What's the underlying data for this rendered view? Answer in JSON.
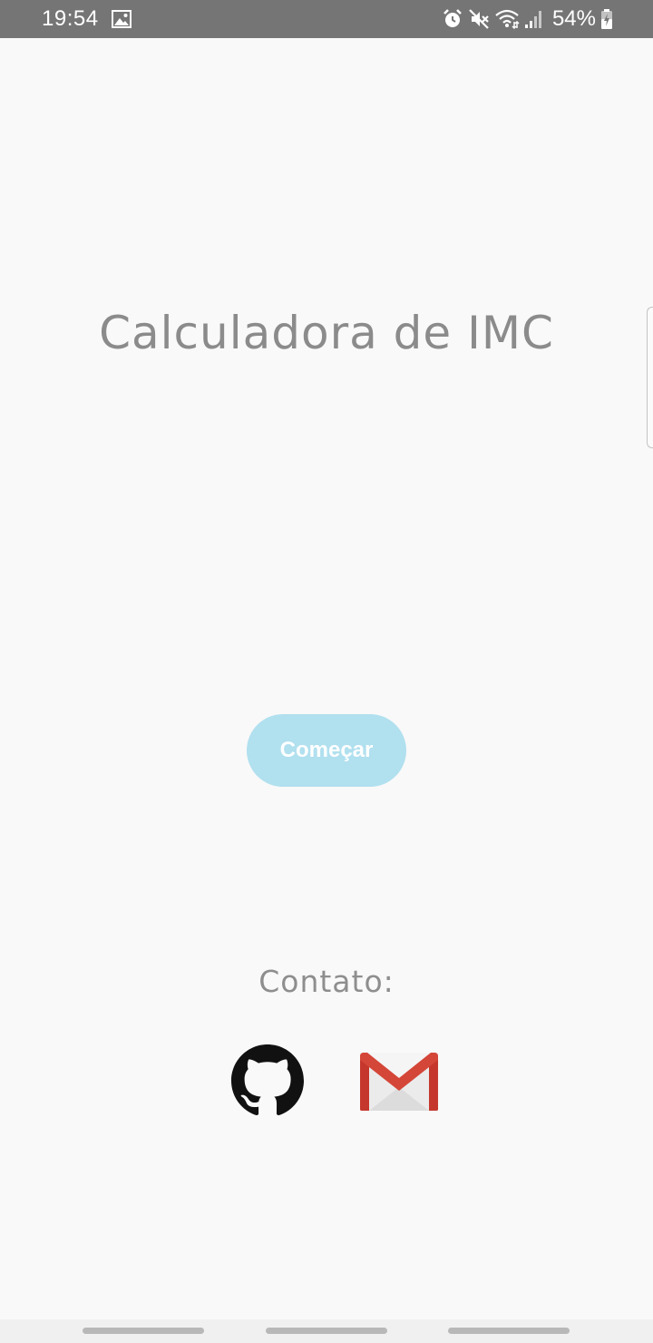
{
  "status_bar": {
    "time": "19:54",
    "battery_percent": "54%",
    "icons": [
      "image-icon",
      "alarm-icon",
      "mute-icon",
      "wifi-icon",
      "signal-icon",
      "battery-charging-icon"
    ],
    "background_color": "#757575"
  },
  "main": {
    "title": "Calculadora de IMC",
    "start_button_label": "Começar",
    "start_button_color": "#b1e0ef"
  },
  "contact": {
    "label": "Contato:",
    "links": [
      {
        "icon": "github-icon"
      },
      {
        "icon": "gmail-icon"
      }
    ]
  },
  "colors": {
    "background": "#f9f9f9",
    "title_text": "#8b8b8b",
    "gmail_red": "#d44638"
  }
}
